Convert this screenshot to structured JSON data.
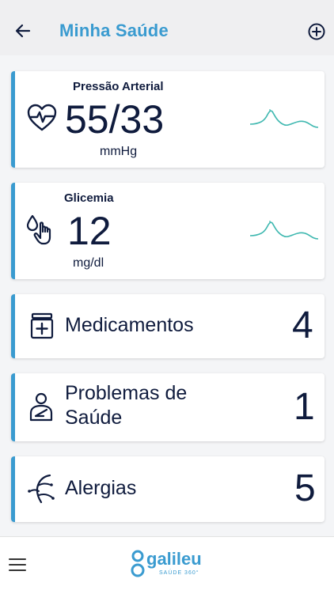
{
  "header": {
    "title": "Minha Saúde",
    "back_icon": "arrow-left-icon",
    "add_icon": "plus-circle-icon"
  },
  "cards": {
    "pressure": {
      "label": "Pressão Arterial",
      "value": "55/33",
      "unit": "mmHg",
      "icon": "heart-pulse-icon"
    },
    "glucose": {
      "label": "Glicemia",
      "value": "12",
      "unit": "mg/dl",
      "icon": "glucose-drop-hand-icon"
    },
    "medications": {
      "label": "Medicamentos",
      "count": "4",
      "icon": "medicine-bottle-icon"
    },
    "problems": {
      "label_line1": "Problemas de",
      "label_line2": "Saúde",
      "count": "1",
      "icon": "person-sling-icon"
    },
    "allergies": {
      "label": "Alergias",
      "count": "5",
      "icon": "allergy-icon"
    }
  },
  "footer": {
    "menu_icon": "hamburger-menu-icon",
    "logo_text": "galileu",
    "logo_sub": "SAÚDE 360°"
  },
  "colors": {
    "accent": "#3a9bd0",
    "text": "#0f1b3d",
    "sparkline": "#3fb8b0"
  }
}
